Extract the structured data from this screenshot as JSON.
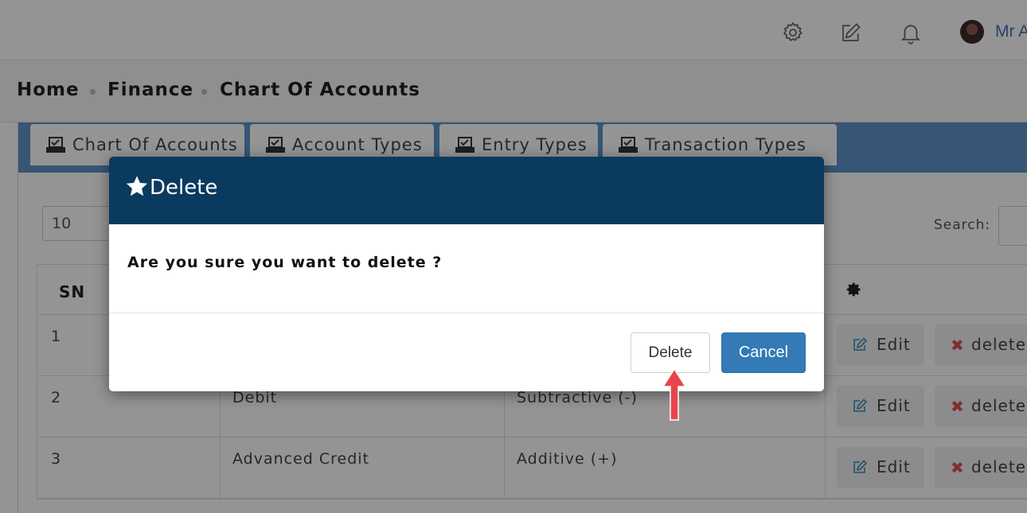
{
  "header": {
    "icons": [
      "gear-icon",
      "edit-icon",
      "bell-icon"
    ],
    "user_name": "Mr A"
  },
  "breadcrumb": [
    "Home",
    "Finance",
    "Chart Of Accounts"
  ],
  "tabs": [
    {
      "label": "Chart Of Accounts"
    },
    {
      "label": "Account Types"
    },
    {
      "label": "Entry Types"
    },
    {
      "label": "Transaction Types"
    }
  ],
  "table_controls": {
    "page_length": "10",
    "search_label": "Search:"
  },
  "table": {
    "headers": {
      "sn": "SN"
    },
    "rows": [
      {
        "sn": "1",
        "name": "",
        "type": "",
        "edit": "Edit",
        "delete": "delete"
      },
      {
        "sn": "2",
        "name": "Debit",
        "type": "Subtractive (-)",
        "edit": "Edit",
        "delete": "delete"
      },
      {
        "sn": "3",
        "name": "Advanced Credit",
        "type": "Additive (+)",
        "edit": "Edit",
        "delete": "delete"
      }
    ]
  },
  "modal": {
    "title": "Delete",
    "message": "Are you sure you want to delete ?",
    "confirm_label": "Delete",
    "cancel_label": "Cancel"
  },
  "colors": {
    "modal_header": "#0b3a5f",
    "tab_strip": "#5f93c8",
    "primary_button": "#337ab7",
    "annotation_arrow": "#e8454b",
    "delete_icon": "#d9534f"
  }
}
